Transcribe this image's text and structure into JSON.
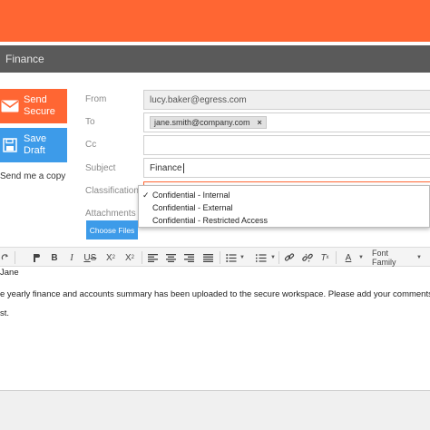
{
  "header": {
    "title": "Finance"
  },
  "actions": {
    "send_label_1": "Send",
    "send_label_2": "Secure",
    "draft_label_1": "Save",
    "draft_label_2": "Draft",
    "copy_label": "Send me a copy"
  },
  "form": {
    "from_label": "From",
    "from_value": "lucy.baker@egress.com",
    "to_label": "To",
    "to_chip": "jane.smith@company.com",
    "to_chip_remove": "×",
    "cc_label": "Cc",
    "subject_label": "Subject",
    "subject_value": "Finance",
    "classification_label": "Classification",
    "attachments_label": "Attachments",
    "choose_files_label": "Choose Files"
  },
  "classification_options": {
    "check": "✓",
    "opt1": "Confidential - Internal",
    "opt2": "Confidential - External",
    "opt3": "Confidential - Restricted Access",
    "selected": "Confidential - Internal"
  },
  "toolbar": {
    "font_family_label": "Font Family"
  },
  "message": {
    "line1": "Jane",
    "line2": "e yearly finance and accounts summary has been uploaded to the secure workspace. Please add your comments prior to",
    "line3": "st."
  },
  "colors": {
    "brand_orange": "#ff6633",
    "accent_blue": "#3d9be9",
    "title_bar": "#5a5a5a"
  }
}
